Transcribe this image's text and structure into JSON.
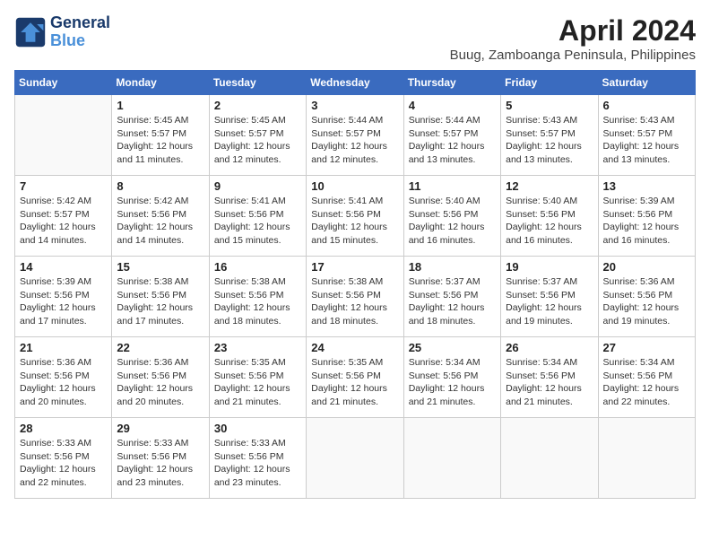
{
  "header": {
    "logo_line1": "General",
    "logo_line2": "Blue",
    "month": "April 2024",
    "location": "Buug, Zamboanga Peninsula, Philippines"
  },
  "days_of_week": [
    "Sunday",
    "Monday",
    "Tuesday",
    "Wednesday",
    "Thursday",
    "Friday",
    "Saturday"
  ],
  "weeks": [
    [
      {
        "num": "",
        "sunrise": "",
        "sunset": "",
        "daylight": "",
        "empty": true
      },
      {
        "num": "1",
        "sunrise": "Sunrise: 5:45 AM",
        "sunset": "Sunset: 5:57 PM",
        "daylight": "Daylight: 12 hours and 11 minutes.",
        "empty": false
      },
      {
        "num": "2",
        "sunrise": "Sunrise: 5:45 AM",
        "sunset": "Sunset: 5:57 PM",
        "daylight": "Daylight: 12 hours and 12 minutes.",
        "empty": false
      },
      {
        "num": "3",
        "sunrise": "Sunrise: 5:44 AM",
        "sunset": "Sunset: 5:57 PM",
        "daylight": "Daylight: 12 hours and 12 minutes.",
        "empty": false
      },
      {
        "num": "4",
        "sunrise": "Sunrise: 5:44 AM",
        "sunset": "Sunset: 5:57 PM",
        "daylight": "Daylight: 12 hours and 13 minutes.",
        "empty": false
      },
      {
        "num": "5",
        "sunrise": "Sunrise: 5:43 AM",
        "sunset": "Sunset: 5:57 PM",
        "daylight": "Daylight: 12 hours and 13 minutes.",
        "empty": false
      },
      {
        "num": "6",
        "sunrise": "Sunrise: 5:43 AM",
        "sunset": "Sunset: 5:57 PM",
        "daylight": "Daylight: 12 hours and 13 minutes.",
        "empty": false
      }
    ],
    [
      {
        "num": "7",
        "sunrise": "Sunrise: 5:42 AM",
        "sunset": "Sunset: 5:57 PM",
        "daylight": "Daylight: 12 hours and 14 minutes.",
        "empty": false
      },
      {
        "num": "8",
        "sunrise": "Sunrise: 5:42 AM",
        "sunset": "Sunset: 5:56 PM",
        "daylight": "Daylight: 12 hours and 14 minutes.",
        "empty": false
      },
      {
        "num": "9",
        "sunrise": "Sunrise: 5:41 AM",
        "sunset": "Sunset: 5:56 PM",
        "daylight": "Daylight: 12 hours and 15 minutes.",
        "empty": false
      },
      {
        "num": "10",
        "sunrise": "Sunrise: 5:41 AM",
        "sunset": "Sunset: 5:56 PM",
        "daylight": "Daylight: 12 hours and 15 minutes.",
        "empty": false
      },
      {
        "num": "11",
        "sunrise": "Sunrise: 5:40 AM",
        "sunset": "Sunset: 5:56 PM",
        "daylight": "Daylight: 12 hours and 16 minutes.",
        "empty": false
      },
      {
        "num": "12",
        "sunrise": "Sunrise: 5:40 AM",
        "sunset": "Sunset: 5:56 PM",
        "daylight": "Daylight: 12 hours and 16 minutes.",
        "empty": false
      },
      {
        "num": "13",
        "sunrise": "Sunrise: 5:39 AM",
        "sunset": "Sunset: 5:56 PM",
        "daylight": "Daylight: 12 hours and 16 minutes.",
        "empty": false
      }
    ],
    [
      {
        "num": "14",
        "sunrise": "Sunrise: 5:39 AM",
        "sunset": "Sunset: 5:56 PM",
        "daylight": "Daylight: 12 hours and 17 minutes.",
        "empty": false
      },
      {
        "num": "15",
        "sunrise": "Sunrise: 5:38 AM",
        "sunset": "Sunset: 5:56 PM",
        "daylight": "Daylight: 12 hours and 17 minutes.",
        "empty": false
      },
      {
        "num": "16",
        "sunrise": "Sunrise: 5:38 AM",
        "sunset": "Sunset: 5:56 PM",
        "daylight": "Daylight: 12 hours and 18 minutes.",
        "empty": false
      },
      {
        "num": "17",
        "sunrise": "Sunrise: 5:38 AM",
        "sunset": "Sunset: 5:56 PM",
        "daylight": "Daylight: 12 hours and 18 minutes.",
        "empty": false
      },
      {
        "num": "18",
        "sunrise": "Sunrise: 5:37 AM",
        "sunset": "Sunset: 5:56 PM",
        "daylight": "Daylight: 12 hours and 18 minutes.",
        "empty": false
      },
      {
        "num": "19",
        "sunrise": "Sunrise: 5:37 AM",
        "sunset": "Sunset: 5:56 PM",
        "daylight": "Daylight: 12 hours and 19 minutes.",
        "empty": false
      },
      {
        "num": "20",
        "sunrise": "Sunrise: 5:36 AM",
        "sunset": "Sunset: 5:56 PM",
        "daylight": "Daylight: 12 hours and 19 minutes.",
        "empty": false
      }
    ],
    [
      {
        "num": "21",
        "sunrise": "Sunrise: 5:36 AM",
        "sunset": "Sunset: 5:56 PM",
        "daylight": "Daylight: 12 hours and 20 minutes.",
        "empty": false
      },
      {
        "num": "22",
        "sunrise": "Sunrise: 5:36 AM",
        "sunset": "Sunset: 5:56 PM",
        "daylight": "Daylight: 12 hours and 20 minutes.",
        "empty": false
      },
      {
        "num": "23",
        "sunrise": "Sunrise: 5:35 AM",
        "sunset": "Sunset: 5:56 PM",
        "daylight": "Daylight: 12 hours and 21 minutes.",
        "empty": false
      },
      {
        "num": "24",
        "sunrise": "Sunrise: 5:35 AM",
        "sunset": "Sunset: 5:56 PM",
        "daylight": "Daylight: 12 hours and 21 minutes.",
        "empty": false
      },
      {
        "num": "25",
        "sunrise": "Sunrise: 5:34 AM",
        "sunset": "Sunset: 5:56 PM",
        "daylight": "Daylight: 12 hours and 21 minutes.",
        "empty": false
      },
      {
        "num": "26",
        "sunrise": "Sunrise: 5:34 AM",
        "sunset": "Sunset: 5:56 PM",
        "daylight": "Daylight: 12 hours and 21 minutes.",
        "empty": false
      },
      {
        "num": "27",
        "sunrise": "Sunrise: 5:34 AM",
        "sunset": "Sunset: 5:56 PM",
        "daylight": "Daylight: 12 hours and 22 minutes.",
        "empty": false
      }
    ],
    [
      {
        "num": "28",
        "sunrise": "Sunrise: 5:33 AM",
        "sunset": "Sunset: 5:56 PM",
        "daylight": "Daylight: 12 hours and 22 minutes.",
        "empty": false
      },
      {
        "num": "29",
        "sunrise": "Sunrise: 5:33 AM",
        "sunset": "Sunset: 5:56 PM",
        "daylight": "Daylight: 12 hours and 23 minutes.",
        "empty": false
      },
      {
        "num": "30",
        "sunrise": "Sunrise: 5:33 AM",
        "sunset": "Sunset: 5:56 PM",
        "daylight": "Daylight: 12 hours and 23 minutes.",
        "empty": false
      },
      {
        "num": "",
        "sunrise": "",
        "sunset": "",
        "daylight": "",
        "empty": true
      },
      {
        "num": "",
        "sunrise": "",
        "sunset": "",
        "daylight": "",
        "empty": true
      },
      {
        "num": "",
        "sunrise": "",
        "sunset": "",
        "daylight": "",
        "empty": true
      },
      {
        "num": "",
        "sunrise": "",
        "sunset": "",
        "daylight": "",
        "empty": true
      }
    ]
  ]
}
